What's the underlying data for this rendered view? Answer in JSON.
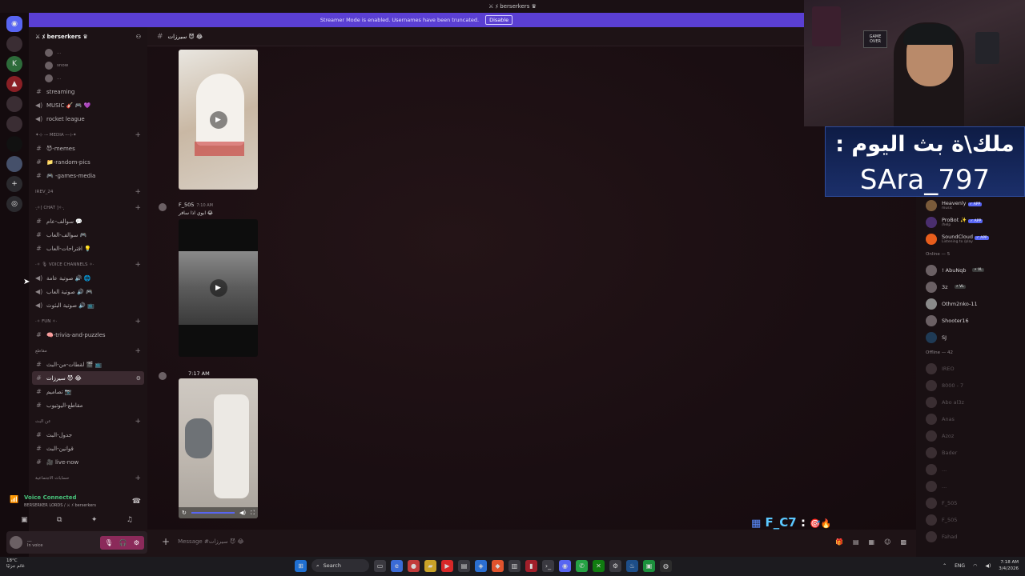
{
  "titlebar": {
    "title": "⚔ ﾒ berserkers ♛"
  },
  "banner": {
    "text": "Streamer Mode is enabled. Usernames have been truncated.",
    "disable": "Disable"
  },
  "server": {
    "name": "⚔ ﾒ berserkers ♛"
  },
  "channels": {
    "voice_users": [
      "...",
      "snow",
      "..."
    ],
    "top": [
      {
        "icon": "hash",
        "label": "streaming"
      },
      {
        "icon": "speaker",
        "label": "MUSIC 🎸 🎮 💜"
      },
      {
        "icon": "speaker",
        "label": "rocket league"
      }
    ],
    "media_cat": "✦⊹ ·╌ MEDIA ╌·⊹✦",
    "media": [
      {
        "icon": "hash",
        "label": "😈-memes"
      },
      {
        "icon": "hash",
        "label": "📁-random-pics"
      },
      {
        "icon": "hash",
        "label": "🎮 -games-media"
      }
    ],
    "irev_cat": "IREV_24",
    "chat_cat": "·̩͙✧[ CHAT ]✧·̩͙",
    "chat": [
      {
        "icon": "hash",
        "label": "سوالف-عام 💬"
      },
      {
        "icon": "hash",
        "label": "سوالف-العاب 🎮"
      },
      {
        "icon": "hash",
        "label": "اقتراحات-العاب 💡"
      }
    ],
    "voice_cat": "·✧ 🎙 Voice Channels ✧·",
    "voice": [
      {
        "icon": "speaker",
        "label": "صوتية عامة 🔊 🌐"
      },
      {
        "icon": "speaker",
        "label": "صوتية العاب 🔊 🎮"
      },
      {
        "icon": "speaker",
        "label": "صوتية البثوث 🔊 📺"
      }
    ],
    "fun_cat": "·✧ FUN ✧·",
    "fun": [
      {
        "icon": "hash",
        "label": "🧠-trivia-and-puzzles"
      }
    ],
    "clips_cat": "مقاطع",
    "clips": [
      {
        "icon": "hash",
        "label": "لقطات-من-البث 🎬 📺"
      },
      {
        "icon": "hash",
        "label": "سيرزات 😈 😂",
        "active": true
      },
      {
        "icon": "hash",
        "label": "تصاميم 📷"
      },
      {
        "icon": "hash",
        "label": "مقاطع-اليوتيوب"
      }
    ],
    "stream_cat": "عن البث",
    "stream": [
      {
        "icon": "hash",
        "label": "جدول-البث"
      },
      {
        "icon": "hash",
        "label": "قوانين-البث"
      },
      {
        "icon": "hash",
        "label": "🎥 live-now"
      }
    ],
    "friends_cat": "حسابات الاجتماعية"
  },
  "voice_panel": {
    "title": "Voice Connected",
    "sub": "BERSERKER LORDS / ⚔ ﾒ berserkers"
  },
  "user_panel": {
    "name": "...",
    "status": "In voice"
  },
  "chat": {
    "channel": "سيرزات 😈 😂",
    "msg1": {
      "author": "F_505",
      "time": "7:10 AM",
      "text": "ابوي اذا سافر 😂"
    },
    "msg2": {
      "time": "7:17 AM"
    },
    "composer_placeholder": "Message #سيرزات 😈 😂"
  },
  "overlay_chat": {
    "user": "F_C7",
    "sep": ":",
    "emoji": "🎯🔥"
  },
  "webcam": {
    "sign": "GAME OVER"
  },
  "king": {
    "line1": ": ملك\\ة بث اليوم",
    "line2": "SAra_797"
  },
  "members": {
    "apps": [
      {
        "name": "Heavenly",
        "tag": "✓ APP",
        "sub": "music"
      },
      {
        "name": "ProBot ✨",
        "tag": "✓ APP",
        "sub": "/help"
      },
      {
        "name": "SoundCloud",
        "tag": "✓ APP",
        "sub": "Listening to /play"
      }
    ],
    "online_label": "Online — 5",
    "online": [
      {
        "name": "! AbuNqb",
        "tag": "⚡ VL"
      },
      {
        "name": "3z",
        "tag": "⚡ VL"
      },
      {
        "name": "Othm2nko-11",
        "tag": ""
      },
      {
        "name": "Shooter16",
        "tag": ""
      },
      {
        "name": "SJ",
        "tag": ""
      }
    ],
    "offline_label": "Offline — 42",
    "offline": [
      "IREO",
      "8000 - 7",
      "Abo al3z",
      "Anas",
      "Azoz",
      "Bader",
      "...",
      "...",
      "F_505",
      "F_505",
      "Fahad"
    ]
  },
  "taskbar": {
    "weather_temp": "18°C",
    "weather_desc": "غائم جزئيًا",
    "search": "Search",
    "lang": "ENG",
    "time": "7:18 AM",
    "date": "3/4/2026"
  },
  "colors": {
    "banner": "#5a3fd3",
    "accent": "#5865f2",
    "voice_green": "#47c27a"
  }
}
